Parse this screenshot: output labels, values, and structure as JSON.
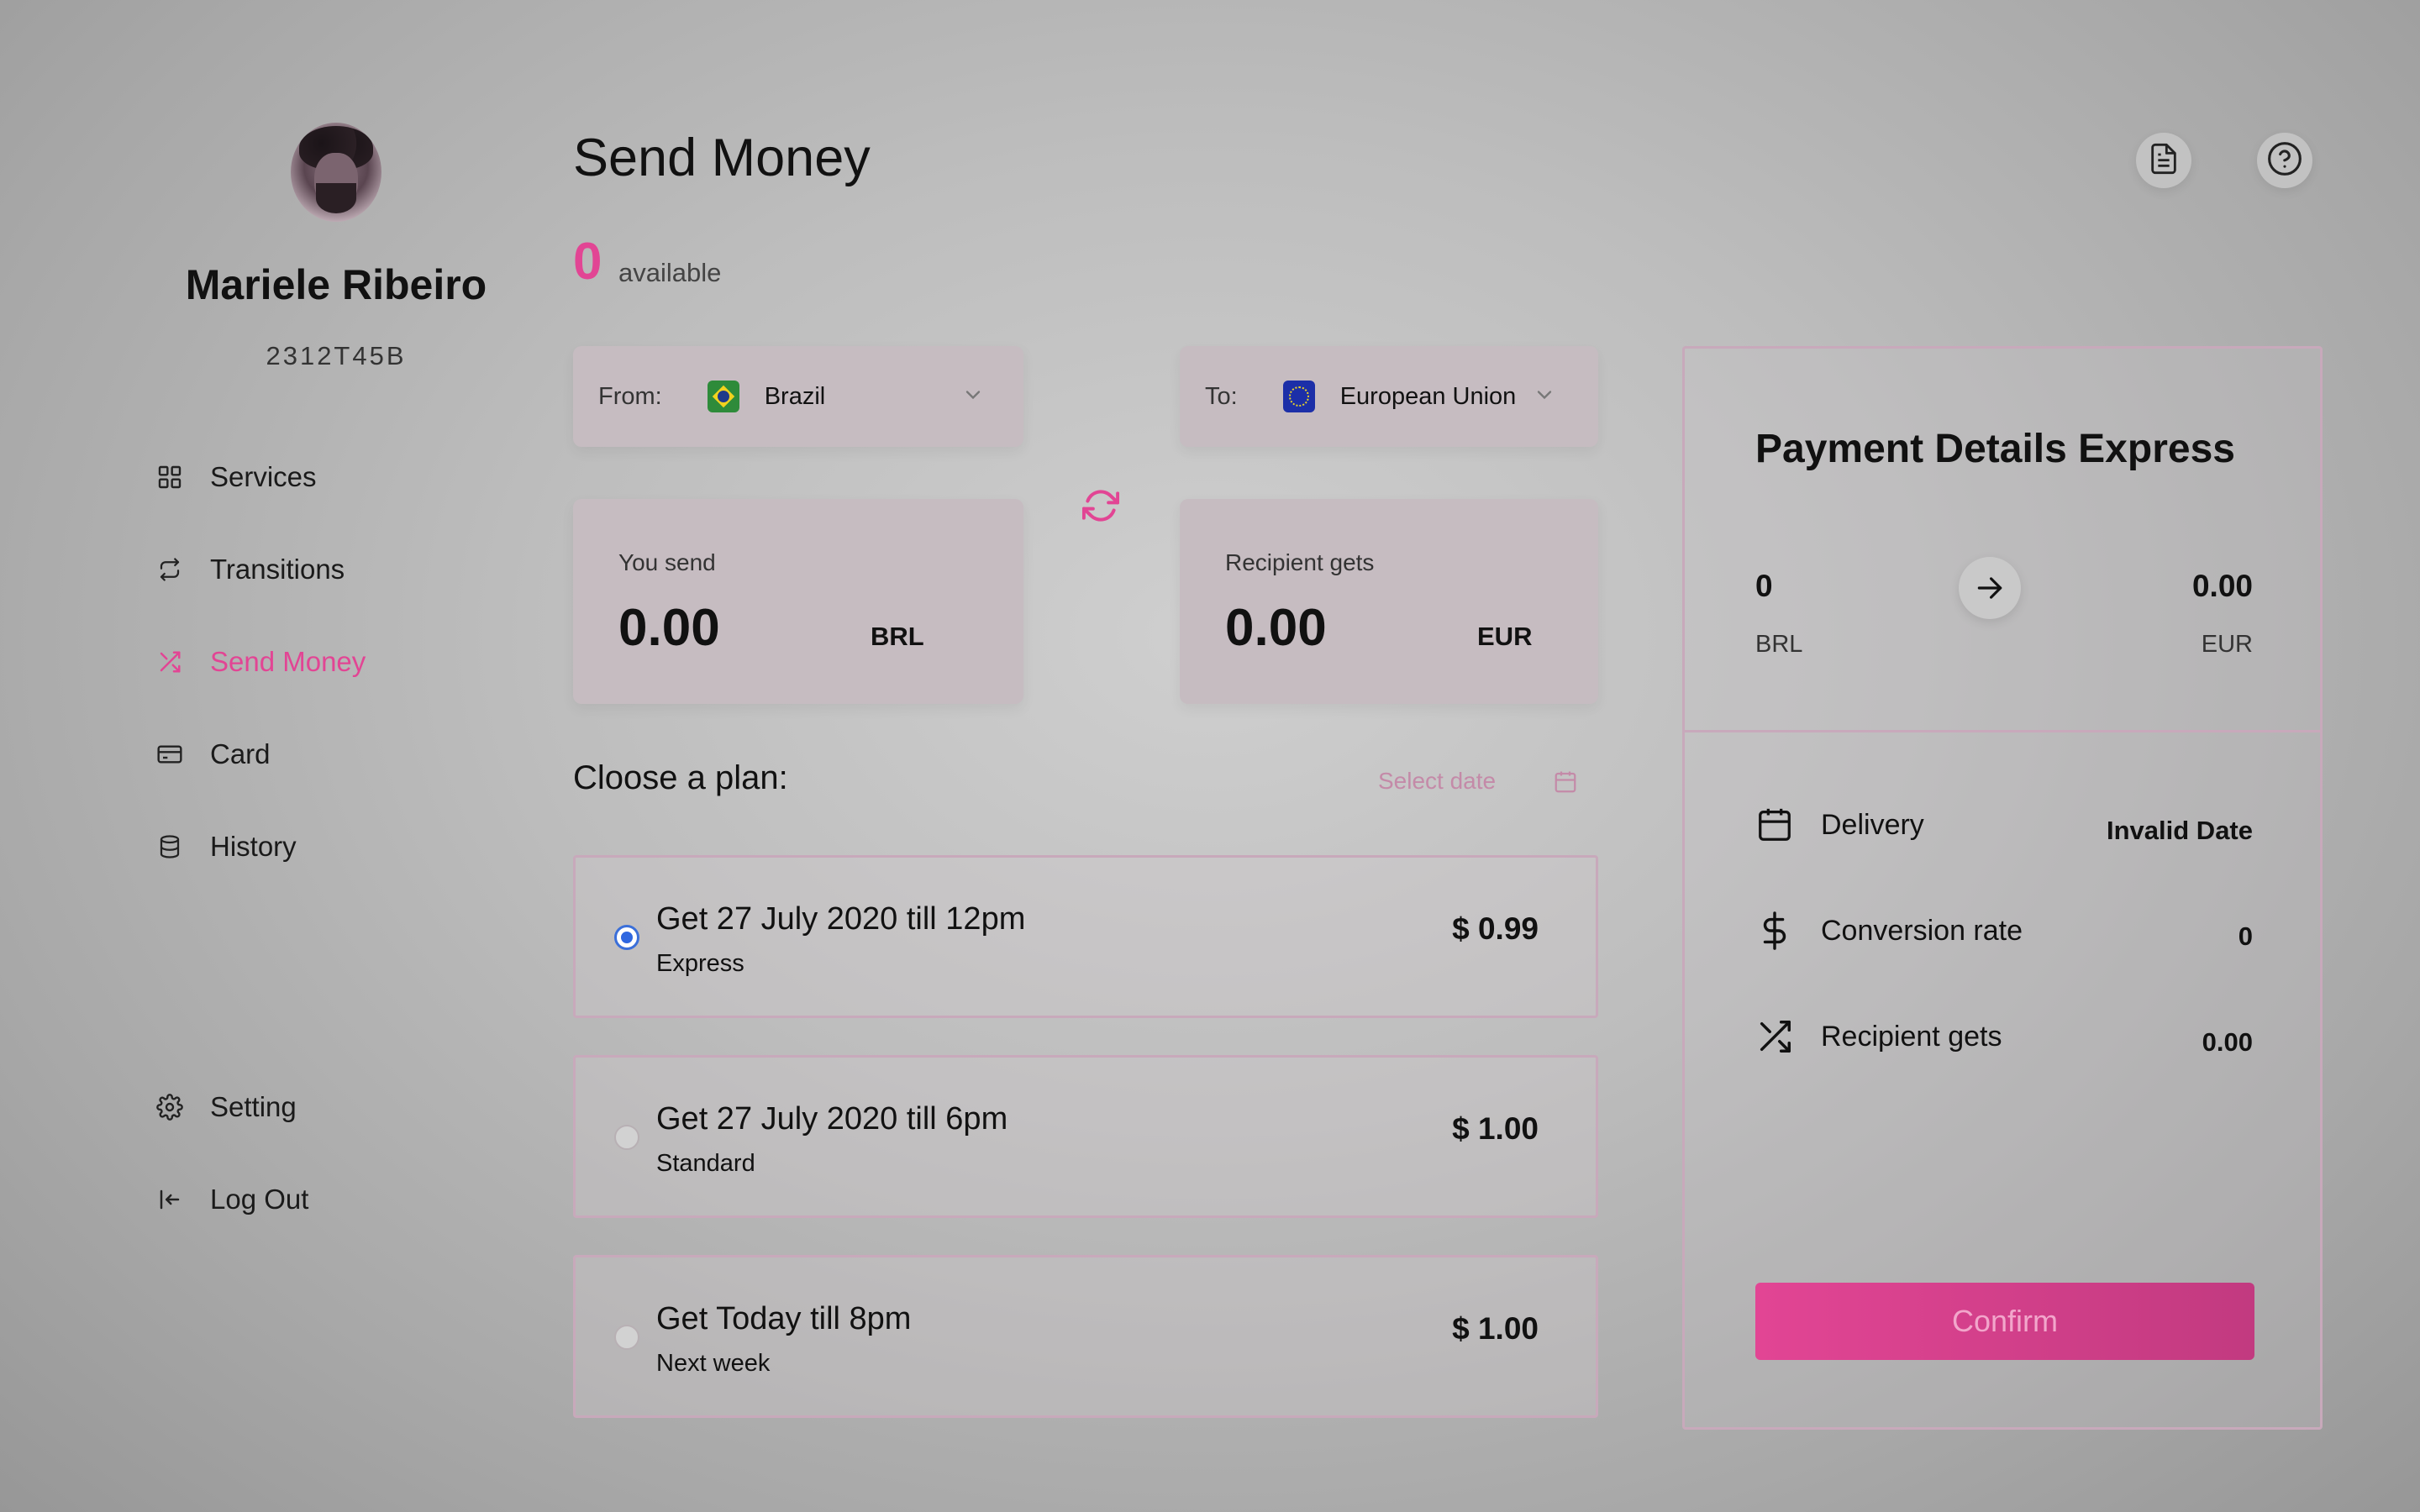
{
  "user": {
    "name": "Mariele Ribeiro",
    "id": "2312T45B"
  },
  "sidebar": {
    "items": [
      {
        "label": "Services",
        "icon": "grid-icon"
      },
      {
        "label": "Transitions",
        "icon": "repeat-icon"
      },
      {
        "label": "Send Money",
        "icon": "shuffle-icon",
        "active": true
      },
      {
        "label": "Card",
        "icon": "credit-card-icon"
      },
      {
        "label": "History",
        "icon": "database-icon"
      }
    ],
    "bottom": [
      {
        "label": "Setting",
        "icon": "gear-icon"
      },
      {
        "label": "Log Out",
        "icon": "logout-icon"
      }
    ]
  },
  "header": {
    "title": "Send Money",
    "available_amount": "0",
    "available_label": "available"
  },
  "transfer": {
    "from": {
      "prefix": "From:",
      "country": "Brazil",
      "flag": "brazil-flag"
    },
    "to": {
      "prefix": "To:",
      "country": "European Union",
      "flag": "eu-flag"
    },
    "send": {
      "label": "You send",
      "value": "0.00",
      "currency": "BRL"
    },
    "receive": {
      "label": "Recipient gets",
      "value": "0.00",
      "currency": "EUR"
    }
  },
  "plans": {
    "title": "Cloose a plan:",
    "select_date_placeholder": "Select date",
    "options": [
      {
        "title": "Get 27 July 2020 till 12pm",
        "subtitle": "Express",
        "price": "$ 0.99",
        "selected": true
      },
      {
        "title": "Get 27 July 2020 till 6pm",
        "subtitle": "Standard",
        "price": "$ 1.00",
        "selected": false
      },
      {
        "title": "Get Today till 8pm",
        "subtitle": "Next week",
        "price": "$ 1.00",
        "selected": false
      }
    ]
  },
  "payment": {
    "title": "Payment Details Express",
    "from_value": "0",
    "from_currency": "BRL",
    "to_value": "0.00",
    "to_currency": "EUR",
    "rows": [
      {
        "label": "Delivery",
        "value": "Invalid Date",
        "icon": "calendar-icon"
      },
      {
        "label": "Conversion rate",
        "value": "0",
        "icon": "dollar-icon"
      },
      {
        "label": "Recipient gets",
        "value": "0.00",
        "icon": "shuffle-icon"
      }
    ],
    "confirm_label": "Confirm"
  },
  "colors": {
    "accent": "#e24594",
    "selected_radio": "#2f67e0"
  }
}
